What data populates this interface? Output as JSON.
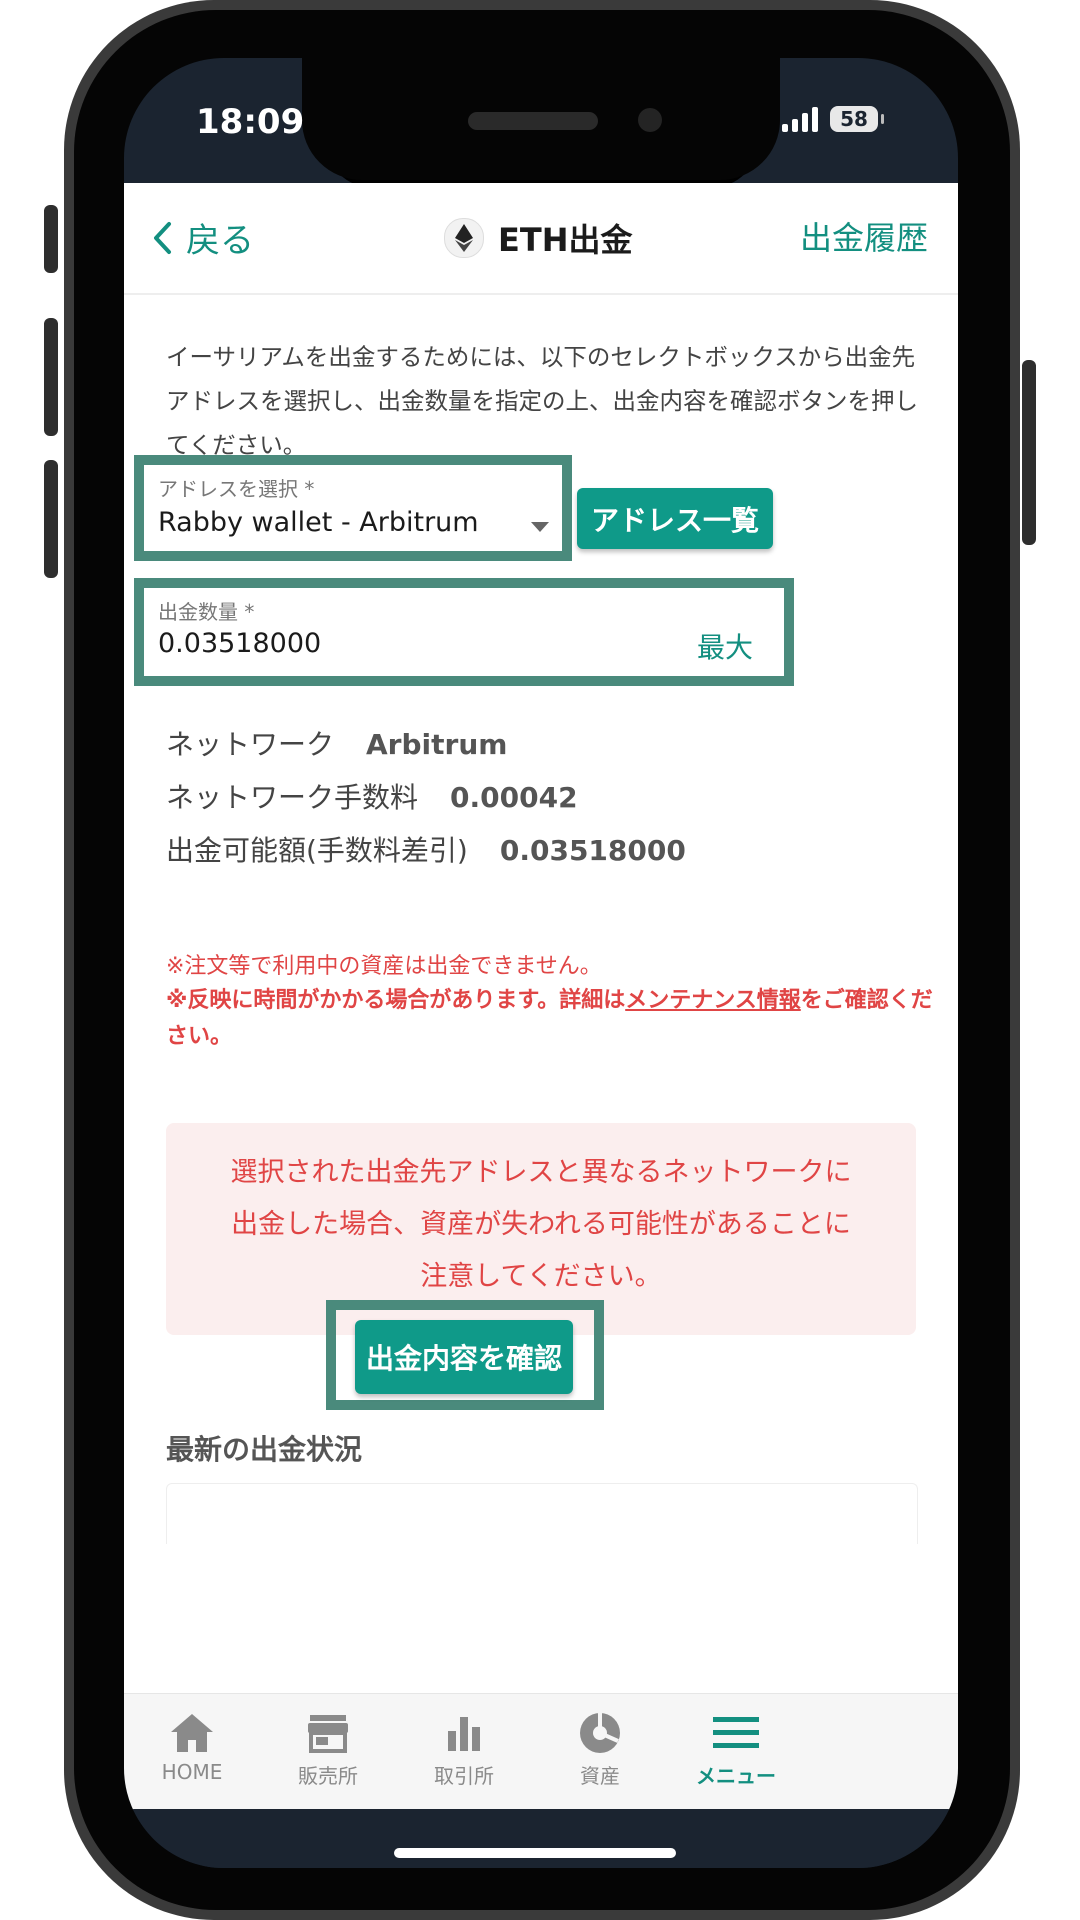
{
  "status_bar": {
    "time": "18:09",
    "battery": "58"
  },
  "header": {
    "back_label": "戻る",
    "title": "ETH出金",
    "history_label": "出金履歴"
  },
  "intro_text": "イーサリアムを出金するためには、以下のセレクトボックスから出金先アドレスを選択し、出金数量を指定の上、出金内容を確認ボタンを押してください。",
  "address_select": {
    "label": "アドレスを選択 *",
    "value": "Rabby wallet - Arbitrum"
  },
  "address_list_button": "アドレス一覧",
  "amount_field": {
    "label": "出金数量 *",
    "value": "0.03518000",
    "max_label": "最大"
  },
  "info": [
    {
      "label": "ネットワーク",
      "value": "Arbitrum"
    },
    {
      "label": "ネットワーク手数料",
      "value": "0.00042"
    },
    {
      "label": "出金可能額(手数料差引)",
      "value": "0.03518000"
    }
  ],
  "notes": {
    "note1": "※注文等で利用中の資産は出金できません。",
    "note2_prefix": "※反映に時間がかかる場合があります。詳細は",
    "note2_link": "メンテナンス情報",
    "note2_suffix": "をご確認ください。"
  },
  "warning_lines": [
    "選択された出金先アドレスと異なるネットワークに",
    "出金した場合、資産が失われる可能性があることに",
    "注意してください。"
  ],
  "confirm_button": "出金内容を確認",
  "latest_title": "最新の出金状況",
  "bottom_nav": [
    {
      "label": "HOME",
      "icon": "home-icon"
    },
    {
      "label": "販売所",
      "icon": "shop-icon"
    },
    {
      "label": "取引所",
      "icon": "bar-chart-icon"
    },
    {
      "label": "資産",
      "icon": "pie-chart-icon"
    },
    {
      "label": "メニュー",
      "icon": "menu-icon",
      "active": true
    }
  ],
  "colors": {
    "accent": "#0f9a89",
    "highlight_frame": "#4a8a7c",
    "warning_red": "#e04545",
    "warning_bg": "#fbeeee"
  }
}
